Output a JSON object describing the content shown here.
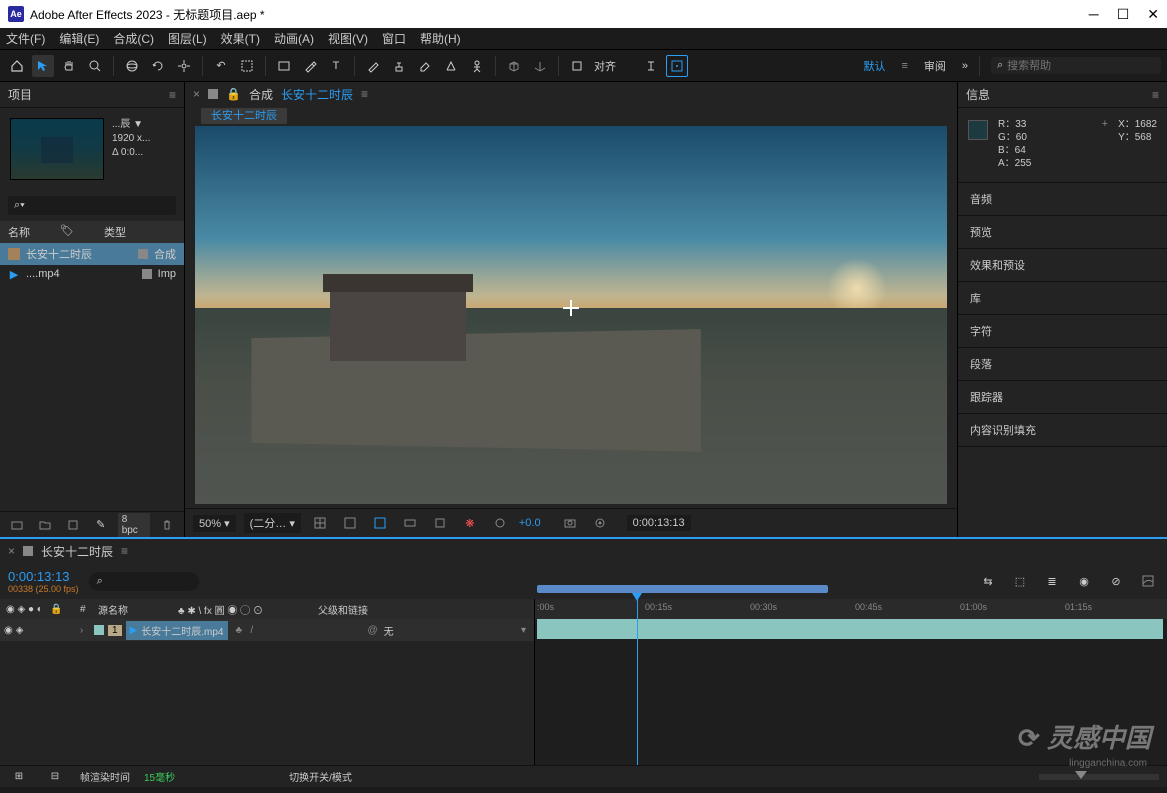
{
  "title": "Adobe After Effects 2023 - 无标题项目.aep *",
  "menu": [
    "文件(F)",
    "编辑(E)",
    "合成(C)",
    "图层(L)",
    "效果(T)",
    "动画(A)",
    "视图(V)",
    "窗口",
    "帮助(H)"
  ],
  "toolbar": {
    "align_label": "对齐",
    "workspace_default": "默认",
    "workspace_review": "审阅",
    "search_placeholder": "搜索帮助"
  },
  "project": {
    "panel_title": "项目",
    "meta_name": "...辰 ▼",
    "meta_res": "1920 x...",
    "meta_dur": "Δ 0:0...",
    "col_name": "名称",
    "col_type": "类型",
    "items": [
      {
        "name": "长安十二时辰",
        "type": "合成",
        "sel": true,
        "icon": "comp"
      },
      {
        "name": "....mp4",
        "type": "Imp",
        "sel": false,
        "icon": "vid"
      }
    ],
    "bpc": "8 bpc"
  },
  "comp": {
    "panel_prefix": "合成",
    "name": "长安十二时辰",
    "breadcrumb": "长安十二时辰",
    "zoom": "50%",
    "res": "(二分…",
    "exposure": "+0.0",
    "timecode": "0:00:13:13"
  },
  "info": {
    "panel_title": "信息",
    "r": "R：33",
    "g": "G：60",
    "b": "B：64",
    "a": "A：255",
    "x": "X：1682",
    "y": "Y：568"
  },
  "right_sections": [
    "音频",
    "预览",
    "效果和预设",
    "库",
    "字符",
    "段落",
    "跟踪器",
    "内容识别填充"
  ],
  "timeline": {
    "name": "长安十二时辰",
    "timecode": "0:00:13:13",
    "framecode": "00338 (25.00 fps)",
    "col_src": "源名称",
    "col_switches": "♣ ✱ \\ fx 圓 ◉ ◯ ⊙",
    "col_parent": "父级和链接",
    "layer_num": "1",
    "layer_name": "长安十二时辰.mp4",
    "parent_val": "无",
    "ticks": [
      ":00s",
      "00:15s",
      "00:30s",
      "00:45s",
      "01:00s",
      "01:15s"
    ],
    "footer_label": "帧渲染时间",
    "footer_val": "15毫秒",
    "switch_label": "切换开关/模式"
  },
  "watermark": "灵感中国",
  "watermark_sub": "lingganchina.com"
}
